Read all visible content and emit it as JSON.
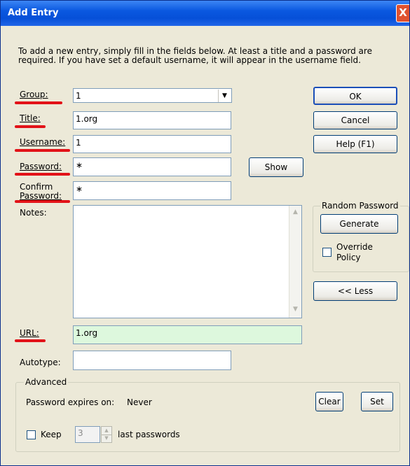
{
  "window": {
    "title": "Add Entry",
    "close_glyph": "X"
  },
  "intro_text": "To add a new entry, simply fill in the fields below. At least a title and a password are required. If you have set a default username, it will appear in the username field.",
  "labels": {
    "group": "Group:",
    "title": "Title:",
    "username": "Username:",
    "password": "Password:",
    "confirm_line1": "Confirm",
    "confirm_line2": "Password:",
    "notes": "Notes:",
    "url": "URL:",
    "autotype": "Autotype:"
  },
  "fields": {
    "group": "1",
    "title": "1.org",
    "username": "1",
    "password": "∗",
    "confirm_password": "∗",
    "notes": "",
    "url": "1.org",
    "autotype": ""
  },
  "buttons": {
    "ok": "OK",
    "cancel": "Cancel",
    "help": "Help (F1)",
    "show": "Show",
    "generate": "Generate",
    "less": "<< Less",
    "clear": "Clear",
    "set": "Set"
  },
  "random_password": {
    "title": "Random Password",
    "override_line1": "Override",
    "override_line2": "Policy",
    "override_checked": false
  },
  "advanced": {
    "title": "Advanced",
    "expires_label": "Password expires on:",
    "expires_value": "Never",
    "keep_label": "Keep",
    "keep_checked": false,
    "keep_count": "3",
    "last_passwords_label": "last passwords"
  },
  "colors": {
    "annotation_red": "#e21218",
    "url_field_bg": "#ddf8dd",
    "titlebar_blue": "#0a58e0"
  },
  "icons": {
    "close": "close-icon",
    "dropdown": "chevron-down-icon",
    "scroll_up": "scroll-up-icon",
    "scroll_down": "scroll-down-icon"
  }
}
